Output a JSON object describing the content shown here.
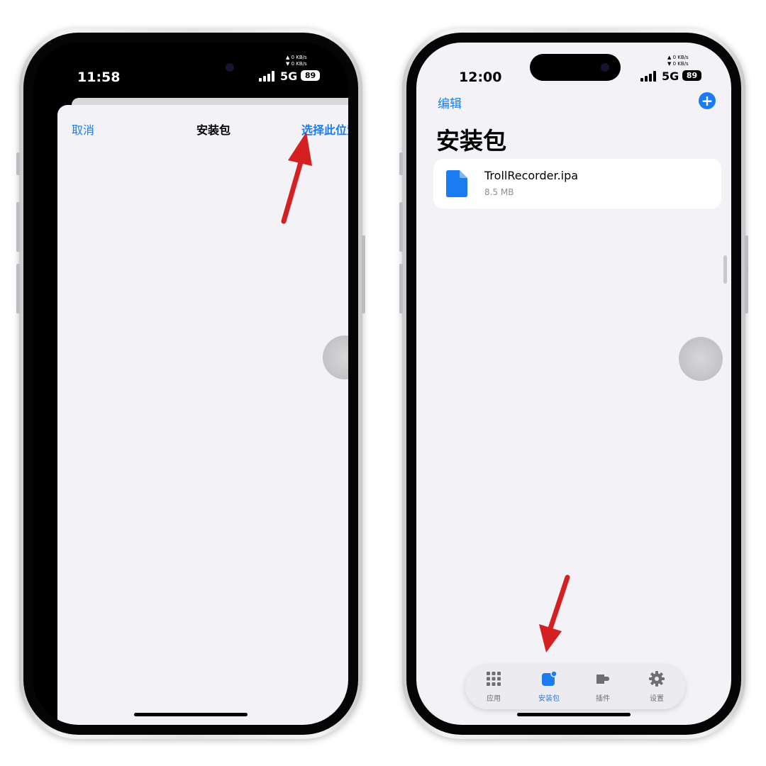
{
  "left_phone": {
    "status": {
      "time": "11:58",
      "network": "5G",
      "battery": "89",
      "upload_speed": "▲ 0 KB/s",
      "download_speed": "▼ 0 KB/s"
    },
    "sheet": {
      "cancel_label": "取消",
      "title": "安装包",
      "select_location_label": "选择此位置"
    }
  },
  "right_phone": {
    "status": {
      "time": "12:00",
      "network": "5G",
      "battery": "89",
      "upload_speed": "▲ 0 KB/s",
      "download_speed": "▼ 0 KB/s"
    },
    "header": {
      "edit_label": "编辑",
      "add_label": "+",
      "title": "安装包"
    },
    "files": [
      {
        "name": "TrollRecorder.ipa",
        "size": "8.5 MB",
        "icon": "document-icon"
      }
    ],
    "tabbar": [
      {
        "label": "应用",
        "icon": "grid-icon",
        "active": false
      },
      {
        "label": "安装包",
        "icon": "package-icon",
        "active": true
      },
      {
        "label": "插件",
        "icon": "plugin-icon",
        "active": false
      },
      {
        "label": "设置",
        "icon": "gear-icon",
        "active": false
      }
    ]
  },
  "colors": {
    "accent": "#1a7cf0",
    "arrow": "#d42020",
    "background": "#f2f2f7"
  }
}
